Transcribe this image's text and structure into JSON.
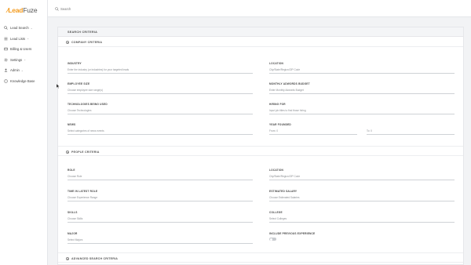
{
  "app": {
    "logo_lead": "Lead",
    "logo_fuze": "Fuze"
  },
  "sidebar": {
    "items": [
      {
        "label": "Lead Search",
        "icon": "search-icon",
        "has_chevron": true
      },
      {
        "label": "Lead Lists",
        "icon": "list-icon",
        "has_chevron": true
      },
      {
        "label": "Billing & Users",
        "icon": "card-icon",
        "has_chevron": false
      },
      {
        "label": "Settings",
        "icon": "gear-icon",
        "has_chevron": true
      },
      {
        "label": "Admin",
        "icon": "user-icon",
        "has_chevron": true
      },
      {
        "label": "Knowledge Base",
        "icon": "question-icon",
        "has_chevron": false
      }
    ]
  },
  "search": {
    "placeholder": "Search"
  },
  "panel": {
    "title": "SEARCH CRITERIA"
  },
  "company": {
    "title": "COMPANY CRITERIA",
    "industry": {
      "label": "INDUSTRY",
      "placeholder": "Enter the industry (or industries) for your targeted leads"
    },
    "location": {
      "label": "LOCATION",
      "placeholder": "City/State/Region/ZIP Code"
    },
    "employee_size": {
      "label": "EMPLOYEE SIZE",
      "placeholder": "Choose employee size range(s)"
    },
    "monthly_adwords": {
      "label": "MONTHLY ADWORDS BUDGET",
      "placeholder": "Enter Monthly Adwords Budget"
    },
    "technologies": {
      "label": "TECHNOLOGIES BEING USED",
      "placeholder": "Choose Technologies"
    },
    "hiring_for": {
      "label": "HIRING FOR",
      "placeholder": "Input job titles to find those hiring"
    },
    "news": {
      "label": "NEWS",
      "placeholder": "Select categories of news events"
    },
    "year_founded": {
      "label": "YEAR FOUNDED",
      "from": "From: 0",
      "to": "To: 0"
    }
  },
  "people": {
    "title": "PEOPLE CRITERIA",
    "role": {
      "label": "ROLE",
      "placeholder": "Choose Role"
    },
    "location": {
      "label": "LOCATION",
      "placeholder": "City/State/Region/ZIP Code"
    },
    "time_latest_role": {
      "label": "TIME IN LATEST ROLE",
      "placeholder": "Choose Experience Range"
    },
    "salary": {
      "label": "ESTIMATED SALARY",
      "placeholder": "Choose Estimated Salaries"
    },
    "skills": {
      "label": "SKILLS",
      "placeholder": "Choose Skills"
    },
    "college": {
      "label": "COLLEGE",
      "placeholder": "Select Colleges"
    },
    "major": {
      "label": "MAJOR",
      "placeholder": "Select Majors"
    },
    "previous_experience": {
      "label": "INCLUDE PREVIOUS EXPERIENCE",
      "enabled": false
    }
  },
  "advanced": {
    "title": "ADVANCED SEARCH CRITERIA"
  },
  "colors": {
    "accent": "#f39a1c",
    "background": "#f2f3f5"
  }
}
